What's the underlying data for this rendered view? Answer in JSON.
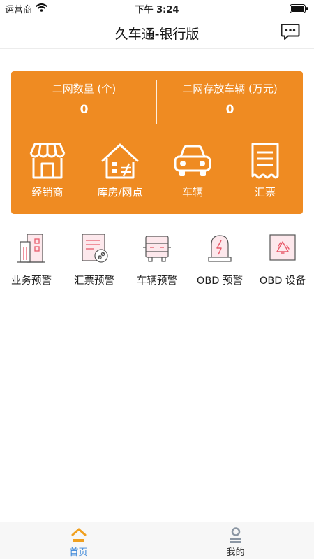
{
  "status_bar": {
    "carrier": "运营商",
    "time": "下午 3:24"
  },
  "nav": {
    "title": "久车通-银行版",
    "message_icon": "chat-bubble-icon"
  },
  "summary_card": {
    "background": "#ef8b22",
    "stats": [
      {
        "label": "二网数量 (个)",
        "value": "0"
      },
      {
        "label": "二网存放车辆 (万元)",
        "value": "0"
      }
    ],
    "items": [
      {
        "label": "经销商",
        "icon": "storefront-icon"
      },
      {
        "label": "库房/网点",
        "icon": "warehouse-icon"
      },
      {
        "label": "车辆",
        "icon": "car-icon"
      },
      {
        "label": "汇票",
        "icon": "bill-icon"
      }
    ]
  },
  "alerts": [
    {
      "label": "业务预警",
      "icon": "buildings-icon"
    },
    {
      "label": "汇票预警",
      "icon": "bill-link-icon"
    },
    {
      "label": "车辆预警",
      "icon": "truck-icon"
    },
    {
      "label": "OBD 预警",
      "icon": "alarm-light-icon"
    },
    {
      "label": "OBD 设备",
      "icon": "recycle-device-icon"
    }
  ],
  "tab_bar": {
    "active_color": "#3a86d8",
    "tabs": [
      {
        "label": "首页",
        "icon": "home-icon",
        "active": true
      },
      {
        "label": "我的",
        "icon": "profile-icon",
        "active": false
      }
    ]
  }
}
